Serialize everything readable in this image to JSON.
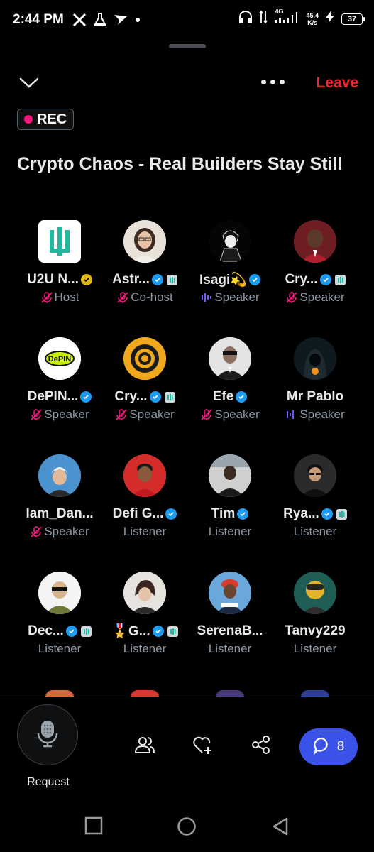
{
  "status_bar": {
    "time": "2:44 PM",
    "network_label": "4G",
    "speed_value": "45.4",
    "speed_unit": "K/s",
    "battery": "37"
  },
  "header": {
    "leave_label": "Leave",
    "rec_label": "REC"
  },
  "space": {
    "title": "Crypto Chaos - Real Builders Stay Still"
  },
  "participants": [
    {
      "name": "U2U N...",
      "role": "Host",
      "badge": "gold",
      "affiliate": false,
      "role_icon": "muted-mic-icon"
    },
    {
      "name": "Astr...",
      "role": "Co-host",
      "badge": "blue",
      "affiliate": true,
      "role_icon": "muted-mic-icon"
    },
    {
      "name": "Isagi💫",
      "role": "Speaker",
      "badge": "blue",
      "affiliate": false,
      "role_icon": "speaking-wave-icon"
    },
    {
      "name": "Cry...",
      "role": "Speaker",
      "badge": "blue",
      "affiliate": true,
      "role_icon": "muted-mic-icon"
    },
    {
      "name": "DePIN...",
      "role": "Speaker",
      "badge": "blue",
      "affiliate": false,
      "role_icon": "muted-mic-icon"
    },
    {
      "name": "Cry...",
      "role": "Speaker",
      "badge": "blue",
      "affiliate": true,
      "role_icon": "muted-mic-icon"
    },
    {
      "name": "Efe",
      "role": "Speaker",
      "badge": "blue",
      "affiliate": false,
      "role_icon": "muted-mic-icon"
    },
    {
      "name": "Mr Pablo",
      "role": "Speaker",
      "badge": "",
      "affiliate": false,
      "role_icon": "speaking-wave-icon"
    },
    {
      "name": "Iam_Dan...",
      "role": "Speaker",
      "badge": "",
      "affiliate": false,
      "role_icon": "muted-mic-icon"
    },
    {
      "name": "Defi G...",
      "role": "Listener",
      "badge": "blue",
      "affiliate": false,
      "role_icon": ""
    },
    {
      "name": "Tim",
      "role": "Listener",
      "badge": "blue",
      "affiliate": false,
      "role_icon": ""
    },
    {
      "name": "Rya...",
      "role": "Listener",
      "badge": "blue",
      "affiliate": true,
      "role_icon": ""
    },
    {
      "name": "Dec...",
      "role": "Listener",
      "badge": "blue",
      "affiliate": true,
      "role_icon": ""
    },
    {
      "name": "🎖️G...",
      "role": "Listener",
      "badge": "blue",
      "affiliate": true,
      "role_icon": ""
    },
    {
      "name": "SerenaB...",
      "role": "Listener",
      "badge": "",
      "affiliate": false,
      "role_icon": ""
    },
    {
      "name": "Tanvy229",
      "role": "Listener",
      "badge": "",
      "affiliate": false,
      "role_icon": ""
    }
  ],
  "bottom_bar": {
    "request_label": "Request",
    "chat_count": "8"
  },
  "colors": {
    "leave": "#f4212e",
    "rec_dot": "#f91880",
    "verified": "#1d9bf0",
    "gold_badge": "#e2b719",
    "chat_button": "#3a52e8",
    "speaking": "#7856ff"
  }
}
